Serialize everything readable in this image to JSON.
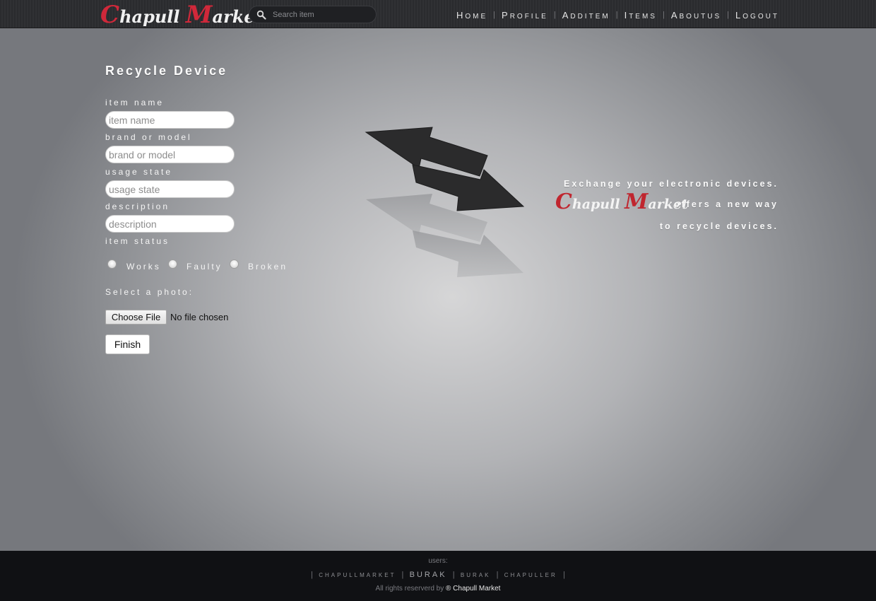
{
  "header": {
    "logo_first": "C",
    "logo_mid": "hapull ",
    "logo_cap2": "M",
    "logo_last": "arket",
    "search_placeholder": "Search item",
    "nav": [
      {
        "label": "Home"
      },
      {
        "label": "Profile"
      },
      {
        "label": "AddItem"
      },
      {
        "label": "Items"
      },
      {
        "label": "AboutUs"
      },
      {
        "label": "Logout"
      }
    ],
    "nav_separator": "|"
  },
  "form": {
    "title": "Recycle Device",
    "item_name_label": "item name",
    "item_name_placeholder": "item name",
    "brand_label": "brand or model",
    "brand_placeholder": "brand or model",
    "usage_label": "usage state",
    "usage_placeholder": "usage state",
    "description_label": "description",
    "description_placeholder": "description",
    "status_label": "item status",
    "status_options": [
      "Works",
      "Faulty",
      "Broken"
    ],
    "photo_label": "Select a photo:",
    "choose_file_label": "Choose File",
    "file_status": "No file chosen",
    "finish_label": "Finish"
  },
  "promo": {
    "line1": "Exchange your electronic devices.",
    "line2": "offers a new way",
    "line3": "to recycle devices.",
    "logo_first": "C",
    "logo_mid": "hapull ",
    "logo_cap2": "M",
    "logo_last": "arket"
  },
  "footer": {
    "users_label": "users:",
    "users": [
      "chapullmarket",
      "Burak",
      "burak",
      "chapuller"
    ],
    "separator": "|",
    "rights_text": "All rights reserverd by",
    "rights_brand": "® Chapull Market"
  },
  "colors": {
    "logo_accent": "#d0283a",
    "topbar": "#2c2d30",
    "footer": "#101114"
  }
}
